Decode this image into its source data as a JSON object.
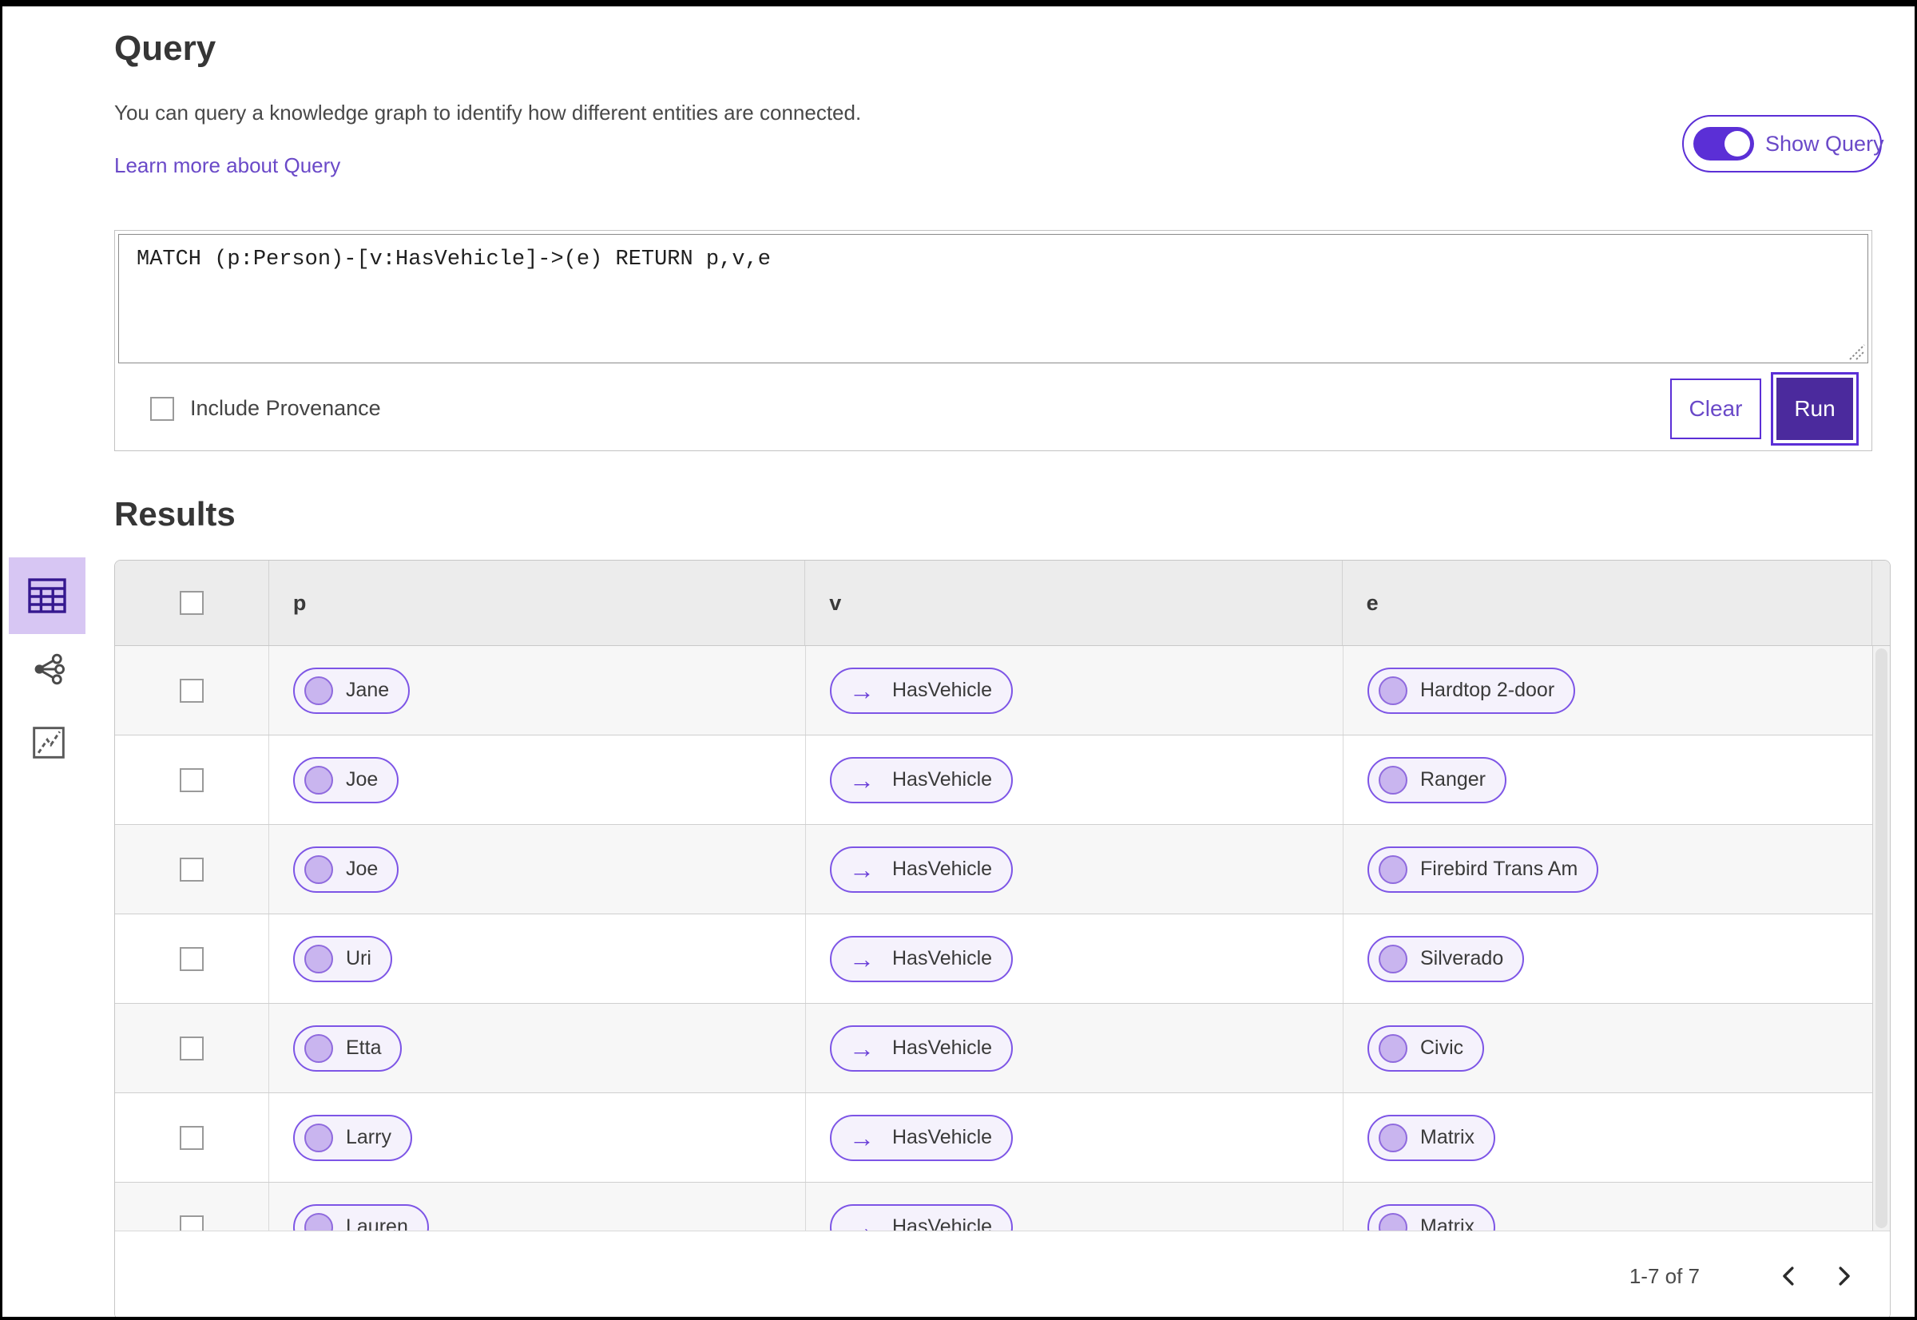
{
  "colors": {
    "accent": "#5b2fd6",
    "accent-text": "#6a49c8",
    "run-fill": "#4b2a9d",
    "pill-border": "#7d55e6",
    "pill-bg": "#f5f2fc",
    "node-fill": "#c9b5ef",
    "node-border": "#8f6ade",
    "sidebar-selected-bg": "#d7c6f3",
    "sidebar-selected-icon": "#35188f",
    "header-bg": "#ececec",
    "row-alt-bg": "#f7f7f7"
  },
  "query_panel": {
    "title": "Query",
    "description": "You can query a knowledge graph to identify how different entities are connected.",
    "learn_more_link": "Learn more about Query",
    "show_query_label": "Show Query",
    "query_text": "MATCH (p:Person)-[v:HasVehicle]->(e) RETURN p,v,e",
    "include_provenance_label": "Include Provenance",
    "clear_button": "Clear",
    "run_button": "Run"
  },
  "results": {
    "title": "Results",
    "columns": [
      "p",
      "v",
      "e"
    ],
    "relationship_arrow": "→",
    "rows": [
      {
        "p": "Jane",
        "v": "HasVehicle",
        "e": "Hardtop 2-door"
      },
      {
        "p": "Joe",
        "v": "HasVehicle",
        "e": "Ranger"
      },
      {
        "p": "Joe",
        "v": "HasVehicle",
        "e": "Firebird Trans Am"
      },
      {
        "p": "Uri",
        "v": "HasVehicle",
        "e": "Silverado"
      },
      {
        "p": "Etta",
        "v": "HasVehicle",
        "e": "Civic"
      },
      {
        "p": "Larry",
        "v": "HasVehicle",
        "e": "Matrix"
      },
      {
        "p": "Lauren",
        "v": "HasVehicle",
        "e": "Matrix"
      }
    ],
    "pagination": {
      "range_label": "1-7 of 7"
    }
  },
  "sidebar": {
    "items": [
      {
        "name": "table-view",
        "selected": true
      },
      {
        "name": "graph-view",
        "selected": false
      },
      {
        "name": "chart-view",
        "selected": false
      }
    ]
  }
}
